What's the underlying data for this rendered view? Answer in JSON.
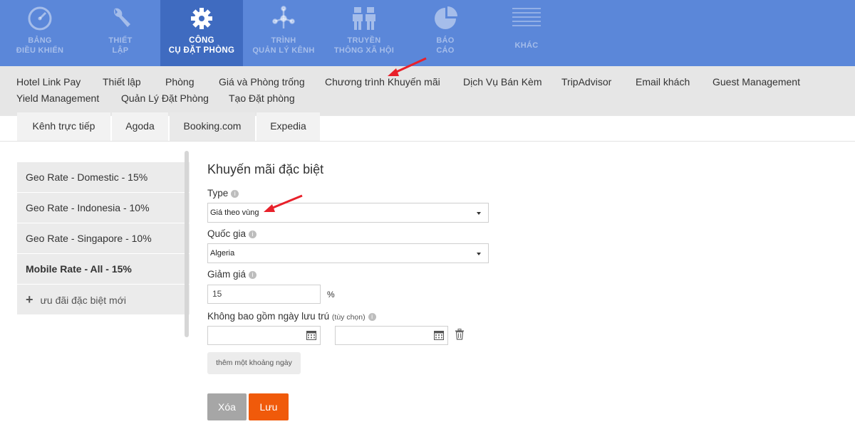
{
  "topnav": {
    "items": [
      {
        "line1": "BẢNG",
        "line2": "ĐIỀU KHIỂN",
        "icon": "gauge-icon"
      },
      {
        "line1": "THIẾT",
        "line2": "LẬP",
        "icon": "wrench-icon"
      },
      {
        "line1": "CÔNG",
        "line2": "CỤ ĐẶT PHÒNG",
        "icon": "gear-icon",
        "active": true
      },
      {
        "line1": "TRÌNH",
        "line2": "QUẢN LÝ KÊNH",
        "icon": "network-icon"
      },
      {
        "line1": "TRUYỀN",
        "line2": "THÔNG XÃ HỘI",
        "icon": "people-icon"
      },
      {
        "line1": "BÁO",
        "line2": "CÁO",
        "icon": "pie-chart-icon"
      },
      {
        "line1": "KHÁC",
        "line2": "",
        "icon": "menu-lines-icon"
      }
    ]
  },
  "submenu": {
    "row1": [
      "Hotel Link Pay",
      "Thiết lập",
      "Phòng",
      "Giá và Phòng trống",
      "Chương trình Khuyến mãi",
      "Dịch Vụ Bán Kèm",
      "TripAdvisor",
      "Email khách",
      "Guest Management"
    ],
    "row2": [
      "Yield Management",
      "Quản Lý Đặt Phòng",
      "Tạo Đặt phòng"
    ]
  },
  "tabs": [
    "Kênh trực tiếp",
    "Agoda",
    "Booking.com",
    "Expedia"
  ],
  "promo_list": {
    "items": [
      "Geo Rate - Domestic - 15%",
      "Geo Rate - Indonesia - 10%",
      "Geo Rate - Singapore - 10%",
      "Mobile Rate - All - 15%"
    ],
    "add_label": "ưu đãi đặc biệt mới"
  },
  "form": {
    "title": "Khuyến mãi đặc biệt",
    "type_label": "Type",
    "type_value": "Giá theo vùng",
    "country_label": "Quốc gia",
    "country_value": "Algeria",
    "discount_label": "Giảm giá",
    "discount_value": "15",
    "discount_unit": "%",
    "exclude_label": "Không bao gồm ngày lưu trú",
    "exclude_optional": "(tùy chọn)",
    "add_range_label": "thêm một khoảng ngày",
    "delete_label": "Xóa",
    "save_label": "Lưu"
  },
  "colors": {
    "topnav_bg": "#5b87d9",
    "topnav_active": "#3f6bc0",
    "save_button": "#f05a0a",
    "annotation_arrow": "#e8202a"
  }
}
